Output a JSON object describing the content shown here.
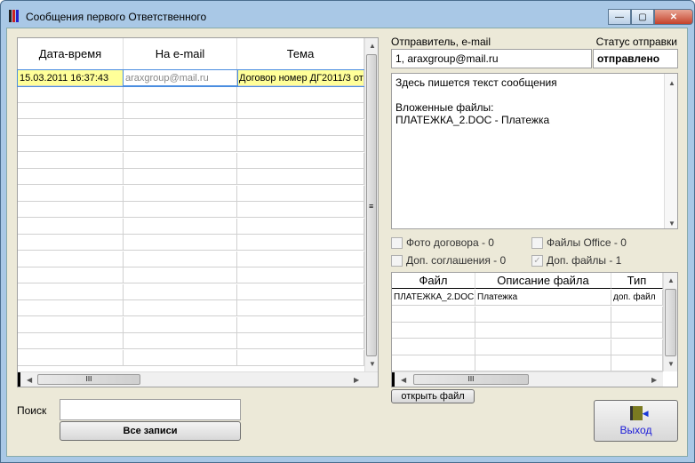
{
  "window": {
    "title": "Сообщения первого Ответственного",
    "minimize": "—",
    "maximize": "▢",
    "close": "✕"
  },
  "messages": {
    "columns": [
      "Дата-время",
      "На e-mail",
      "Тема"
    ],
    "rows": [
      [
        "15.03.2011 16:37:43",
        "araxgroup@mail.ru",
        "Договор номер ДГ2011/3 от"
      ]
    ]
  },
  "sender": {
    "label": "Отправитель, e-mail",
    "value": "1, araxgroup@mail.ru"
  },
  "status": {
    "label": "Статус отправки",
    "value": "отправлено"
  },
  "body": [
    "Здесь пишется текст сообщения",
    "",
    "Вложенные файлы:",
    "ПЛАТЕЖКА_2.DOC - Платежка"
  ],
  "checks": [
    {
      "label": "Фото договора - 0",
      "checked": false
    },
    {
      "label": "Файлы Office - 0",
      "checked": false
    },
    {
      "label": "Доп. соглашения - 0",
      "checked": false
    },
    {
      "label": "Доп. файлы - 1",
      "checked": true
    }
  ],
  "files": {
    "columns": [
      "Файл",
      "Описание файла",
      "Тип"
    ],
    "rows": [
      [
        "ПЛАТЕЖКА_2.DOC",
        "Платежка",
        "доп. файл"
      ]
    ]
  },
  "open_file": "открыть файл",
  "search": {
    "label": "Поиск",
    "value": "",
    "all_records": "Все записи"
  },
  "exit": "Выход",
  "scroll_grip": "III",
  "scroll_grip_v": "≡"
}
